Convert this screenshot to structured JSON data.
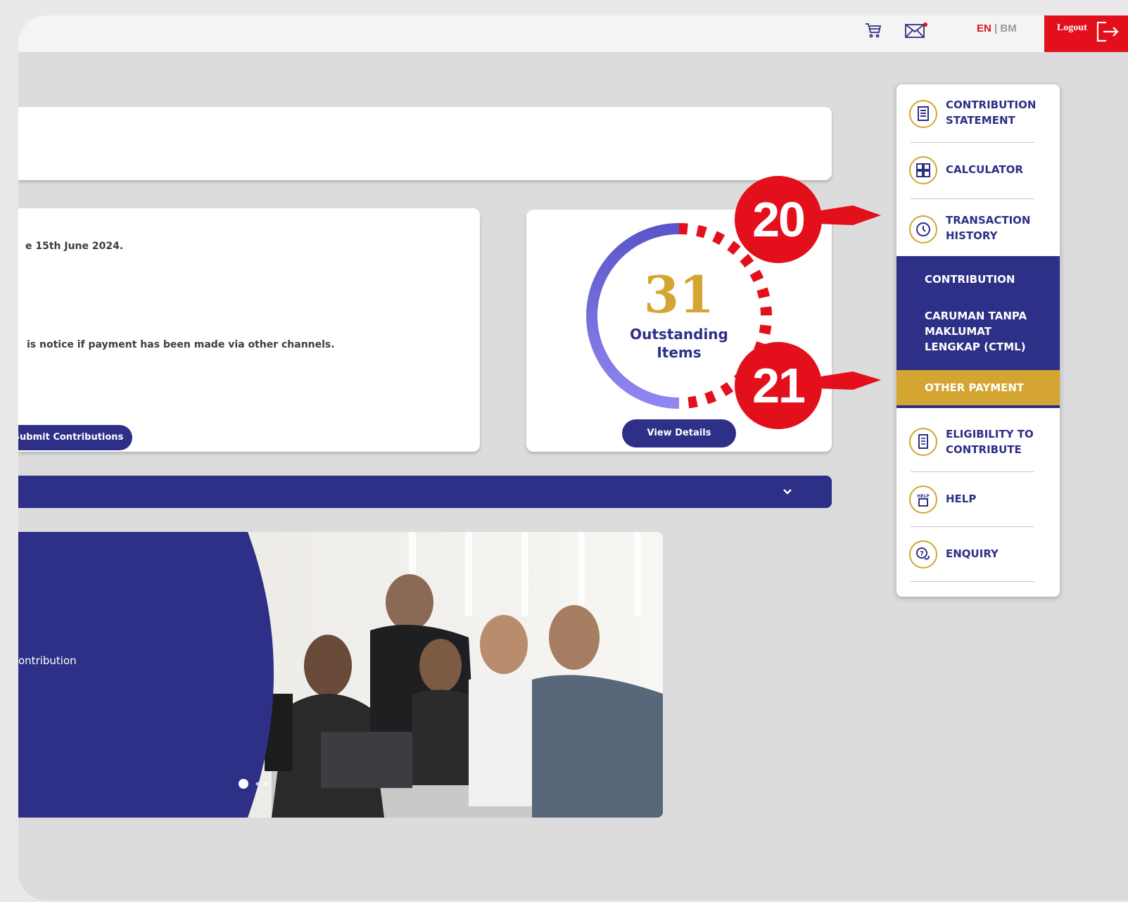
{
  "topbar": {
    "lang_en": "EN",
    "lang_sep": " | ",
    "lang_bm": "BM",
    "logout_label": "Logout"
  },
  "notice": {
    "line1": "e 15th June 2024.",
    "line2": "is notice if payment has been made via other channels.",
    "submit_label": "Submit Contributions"
  },
  "outstanding": {
    "count": "31",
    "label_line1": "Outstanding",
    "label_line2": "Items",
    "view_label": "View Details"
  },
  "banner": {
    "text": "ontribution"
  },
  "menu": {
    "items": [
      {
        "line1": "CONTRIBUTION",
        "line2": "STATEMENT",
        "icon": "document-icon"
      },
      {
        "line1": "CALCULATOR",
        "line2": "",
        "icon": "calculator-icon"
      },
      {
        "line1": "TRANSACTION",
        "line2": "HISTORY",
        "icon": "clock-icon"
      },
      {
        "line1": "ELIGIBILITY TO",
        "line2": "CONTRIBUTE",
        "icon": "checklist-icon"
      },
      {
        "line1": "HELP",
        "line2": "",
        "icon": "help-icon"
      },
      {
        "line1": "ENQUIRY",
        "line2": "",
        "icon": "enquiry-icon"
      }
    ],
    "submenu": {
      "contribution": "CONTRIBUTION",
      "ctml_line1": "CARUMAN TANPA",
      "ctml_line2": "MAKLUMAT",
      "ctml_line3": "LENGKAP (CTML)",
      "other_payment": "OTHER PAYMENT"
    }
  },
  "callouts": {
    "first": "20",
    "second": "21"
  },
  "colors": {
    "brand_navy": "#2e2f86",
    "accent_gold": "#d4a531",
    "alert_red": "#e3101b"
  }
}
